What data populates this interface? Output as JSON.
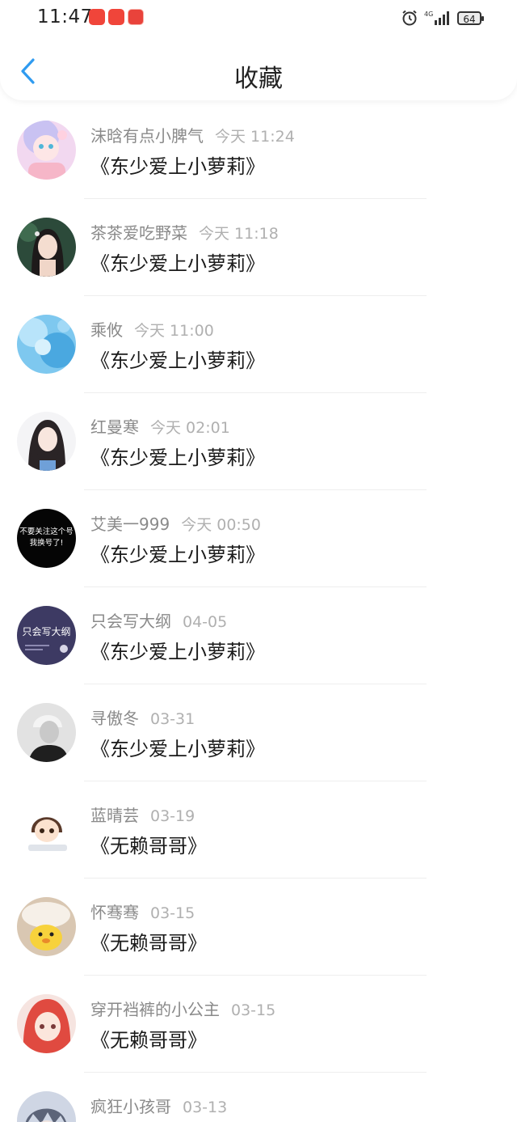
{
  "status_bar": {
    "time": "11:47",
    "battery": "64",
    "network": "4G"
  },
  "nav": {
    "title": "收藏"
  },
  "favorites": [
    {
      "name": "沫晗有点小脾气",
      "time": "今天 11:24",
      "title": "《东少爱上小萝莉》",
      "avatar": "anime-girl-avatar"
    },
    {
      "name": "茶茶爱吃野菜",
      "time": "今天 11:18",
      "title": "《东少爱上小萝莉》",
      "avatar": "girl-portrait-avatar"
    },
    {
      "name": "乘攸",
      "time": "今天 11:00",
      "title": "《东少爱上小萝莉》",
      "avatar": "blue-water-avatar"
    },
    {
      "name": "红曼寒",
      "time": "今天 02:01",
      "title": "《东少爱上小萝莉》",
      "avatar": "braided-girl-avatar"
    },
    {
      "name": "艾美一999",
      "time": "今天 00:50",
      "title": "《东少爱上小萝莉》",
      "avatar": "black-text-avatar",
      "avatar_text": [
        "不要关注这个号",
        "我换号了!"
      ]
    },
    {
      "name": "只会写大纲",
      "time": "04-05",
      "title": "《东少爱上小萝莉》",
      "avatar": "purple-text-avatar",
      "avatar_text": [
        "只会写大纲"
      ]
    },
    {
      "name": "寻傲冬",
      "time": "03-31",
      "title": "《东少爱上小萝莉》",
      "avatar": "grayscale-person-avatar"
    },
    {
      "name": "蓝晴芸",
      "time": "03-19",
      "title": "《无赖哥哥》",
      "avatar": "cartoon-girl-avatar"
    },
    {
      "name": "怀骞骞",
      "time": "03-15",
      "title": "《无赖哥哥》",
      "avatar": "yellow-duck-avatar"
    },
    {
      "name": "穿开裆裤的小公主",
      "time": "03-15",
      "title": "《无赖哥哥》",
      "avatar": "red-hair-anime-avatar"
    },
    {
      "name": "疯狂小孩哥",
      "time": "03-13",
      "title": "",
      "avatar": "anime-boy-avatar"
    }
  ],
  "colors": {
    "accent": "#2f9bf0",
    "name_text": "#8a8a8a",
    "time_text": "#b0b0b0",
    "title_text": "#1a1a1a"
  }
}
